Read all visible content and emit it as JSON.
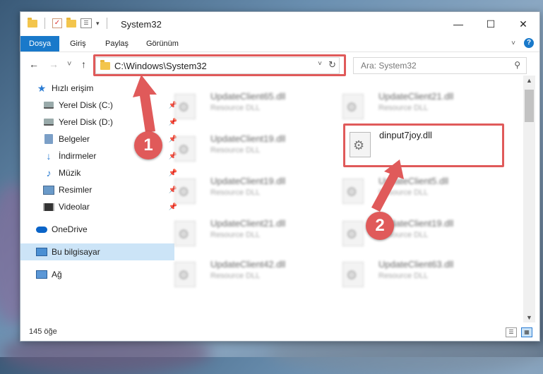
{
  "window": {
    "title": "System32",
    "controls": {
      "minimize": "—",
      "maximize": "☐",
      "close": "✕"
    }
  },
  "ribbon": {
    "tabs": [
      {
        "label": "Dosya",
        "active": true
      },
      {
        "label": "Giriş",
        "active": false
      },
      {
        "label": "Paylaş",
        "active": false
      },
      {
        "label": "Görünüm",
        "active": false
      }
    ],
    "help_label": "?"
  },
  "nav": {
    "back": "←",
    "forward": "→",
    "recent": "˅",
    "up": "↑",
    "address": "C:\\Windows\\System32",
    "search_placeholder": "Ara: System32"
  },
  "sidebar": {
    "items": [
      {
        "label": "Hızlı erişim",
        "icon": "star-icon",
        "pinned": false
      },
      {
        "label": "Yerel Disk (C:)",
        "icon": "disk-icon",
        "pinned": true
      },
      {
        "label": "Yerel Disk (D:)",
        "icon": "disk-icon",
        "pinned": true
      },
      {
        "label": "Belgeler",
        "icon": "documents-icon",
        "pinned": true
      },
      {
        "label": "İndirmeler",
        "icon": "download-icon",
        "pinned": true
      },
      {
        "label": "Müzik",
        "icon": "music-icon",
        "pinned": true
      },
      {
        "label": "Resimler",
        "icon": "pictures-icon",
        "pinned": true
      },
      {
        "label": "Videolar",
        "icon": "videos-icon",
        "pinned": true
      },
      {
        "label": "OneDrive",
        "icon": "cloud-icon",
        "pinned": false
      },
      {
        "label": "Bu bilgisayar",
        "icon": "computer-icon",
        "pinned": false,
        "selected": true
      },
      {
        "label": "Ağ",
        "icon": "network-icon",
        "pinned": false
      }
    ]
  },
  "files": [
    {
      "name": "UpdateClient65.dll",
      "type": "Resource DLL"
    },
    {
      "name": "UpdateClient21.dll",
      "type": "Resource DLL"
    },
    {
      "name": "UpdateClient19.dll",
      "type": "Resource DLL"
    },
    {
      "name": "dinput7joy.dll",
      "type": ""
    },
    {
      "name": "UpdateClient19.dll",
      "type": "Resource DLL"
    },
    {
      "name": "UpdateClient5.dll",
      "type": "Resource DLL"
    },
    {
      "name": "UpdateClient21.dll",
      "type": "Resource DLL"
    },
    {
      "name": "UpdateClient19.dll",
      "type": "Resource DLL"
    },
    {
      "name": "UpdateClient42.dll",
      "type": "Resource DLL"
    },
    {
      "name": "UpdateClient63.dll",
      "type": "Resource DLL"
    }
  ],
  "status": {
    "item_count": "145 öğe"
  },
  "annotations": {
    "badge1": "1",
    "badge2": "2",
    "highlight_color": "#e05a5a"
  },
  "colors": {
    "accent": "#1979ca",
    "selection": "#cce4f7"
  }
}
